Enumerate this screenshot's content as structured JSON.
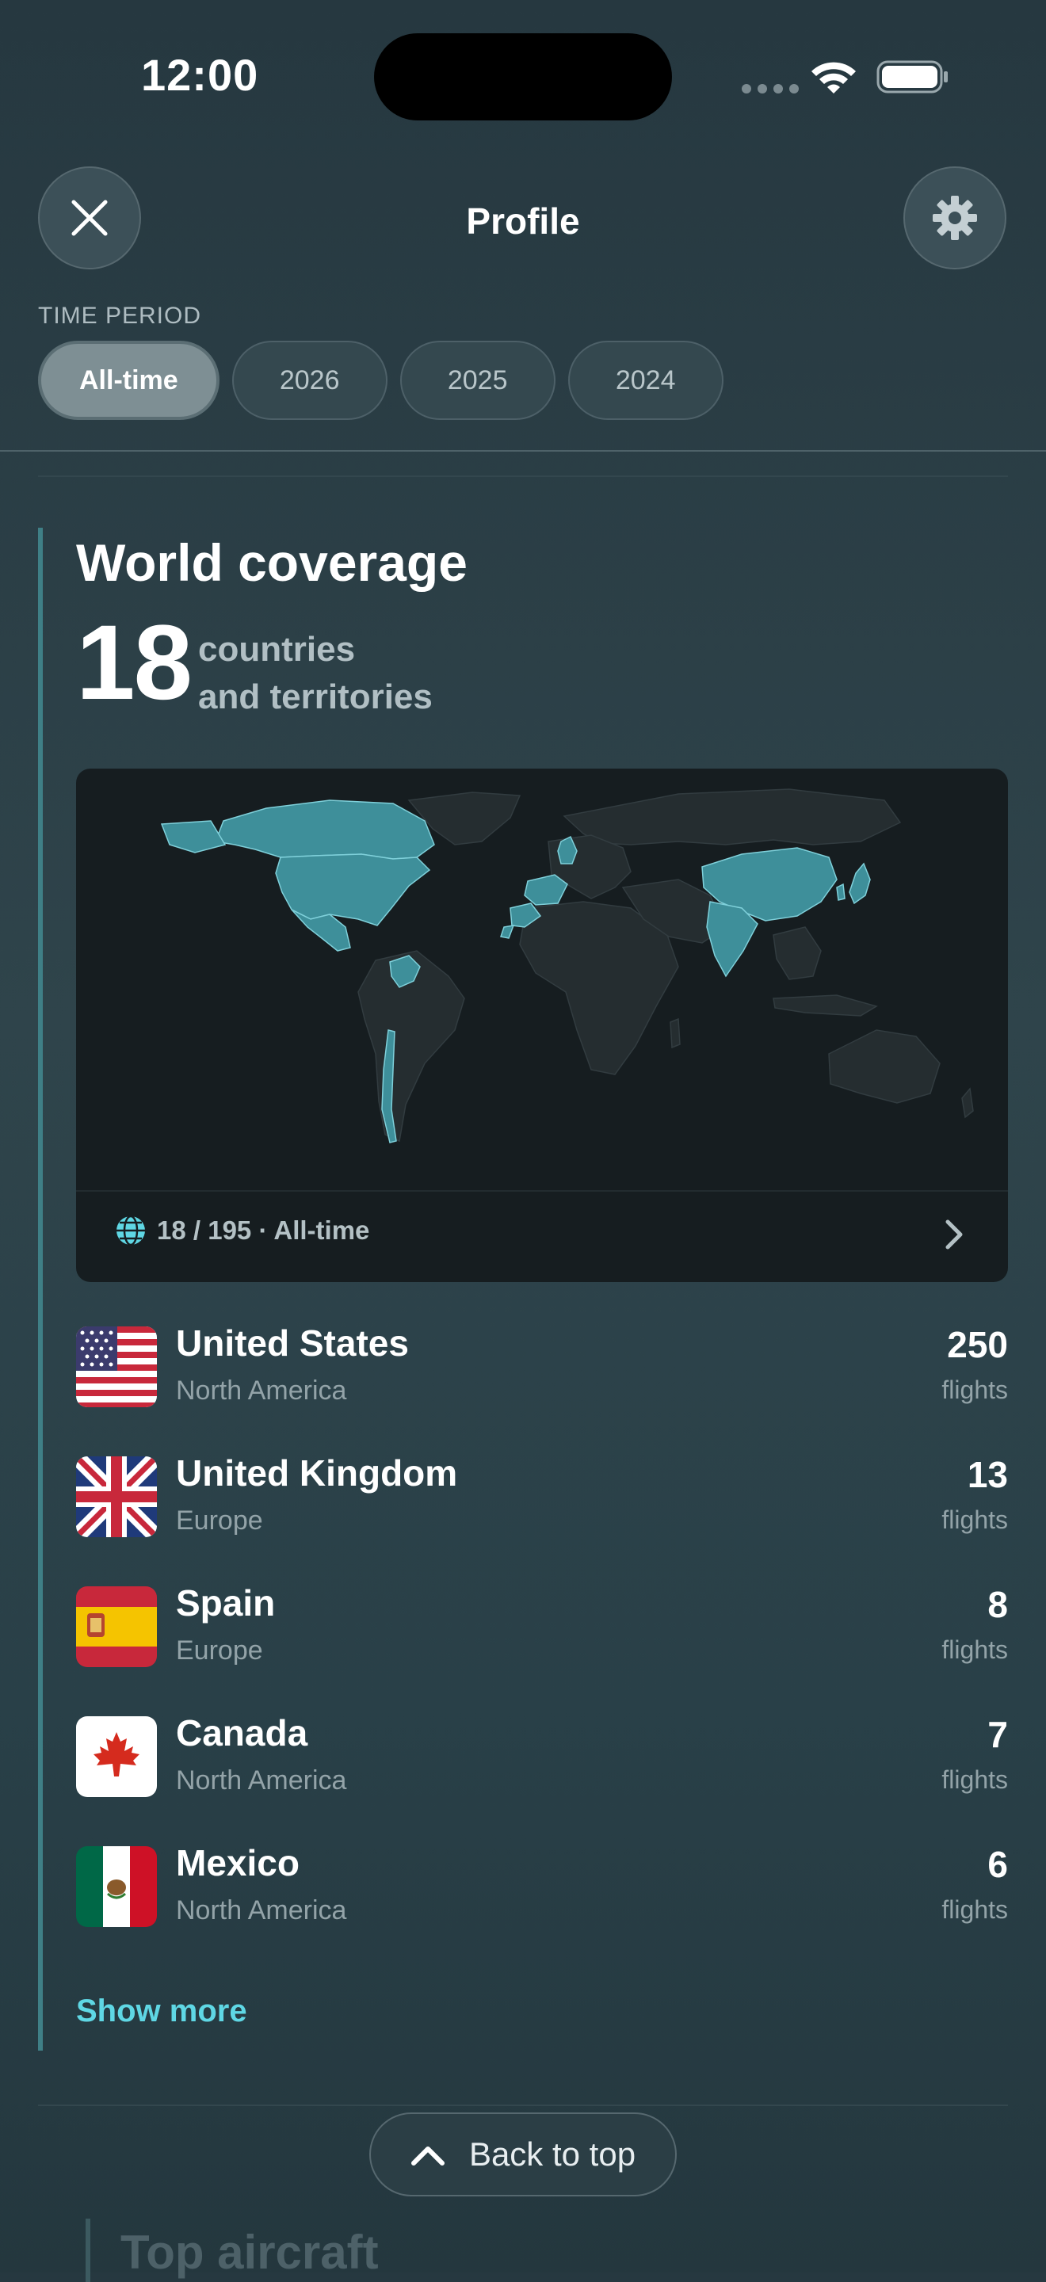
{
  "status_bar": {
    "time": "12:00"
  },
  "header": {
    "title": "Profile"
  },
  "time_period": {
    "label": "TIME PERIOD",
    "options": [
      "All-time",
      "2026",
      "2025",
      "2024"
    ],
    "selected": "All-time"
  },
  "world_coverage": {
    "title": "World coverage",
    "count": "18",
    "count_label_line1": "countries",
    "count_label_line2": "and territories",
    "map_footer": "18 / 195 · All-time",
    "highlight_color": "#3e8f9a"
  },
  "countries": [
    {
      "name": "United States",
      "region": "North America",
      "flights": "250",
      "unit": "flights",
      "flag": "us-flag"
    },
    {
      "name": "United Kingdom",
      "region": "Europe",
      "flights": "13",
      "unit": "flights",
      "flag": "uk-flag"
    },
    {
      "name": "Spain",
      "region": "Europe",
      "flights": "8",
      "unit": "flights",
      "flag": "spain-flag"
    },
    {
      "name": "Canada",
      "region": "North America",
      "flights": "7",
      "unit": "flights",
      "flag": "canada-flag"
    },
    {
      "name": "Mexico",
      "region": "North America",
      "flights": "6",
      "unit": "flights",
      "flag": "mexico-flag"
    }
  ],
  "show_more": "Show more",
  "back_to_top": "Back to top",
  "next_section_title": "Top aircraft",
  "colors": {
    "accent": "#5fd7e4",
    "background": "#2f444b"
  }
}
